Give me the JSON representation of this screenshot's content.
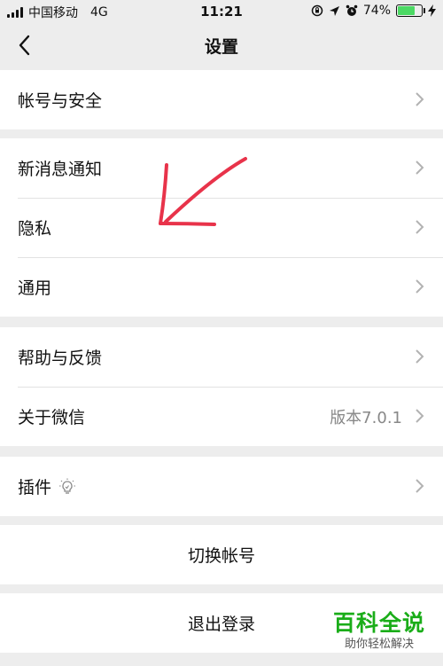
{
  "status_bar": {
    "carrier": "中国移动",
    "network": "4G",
    "time": "11:21",
    "battery_percent": "74%",
    "battery_level": 0.74
  },
  "nav": {
    "title": "设置"
  },
  "groups": [
    {
      "items": [
        {
          "label": "帐号与安全"
        }
      ]
    },
    {
      "items": [
        {
          "label": "新消息通知"
        },
        {
          "label": "隐私"
        },
        {
          "label": "通用"
        }
      ]
    },
    {
      "items": [
        {
          "label": "帮助与反馈"
        },
        {
          "label": "关于微信",
          "value": "版本7.0.1"
        }
      ]
    },
    {
      "items": [
        {
          "label": "插件"
        }
      ]
    }
  ],
  "actions": {
    "switch_account": "切换帐号",
    "logout": "退出登录"
  },
  "watermark": {
    "main": "百科全说",
    "sub": "助你轻松解决"
  },
  "colors": {
    "annotation_arrow": "#e8334a",
    "battery": "#4cd964",
    "watermark": "#1aad19"
  }
}
